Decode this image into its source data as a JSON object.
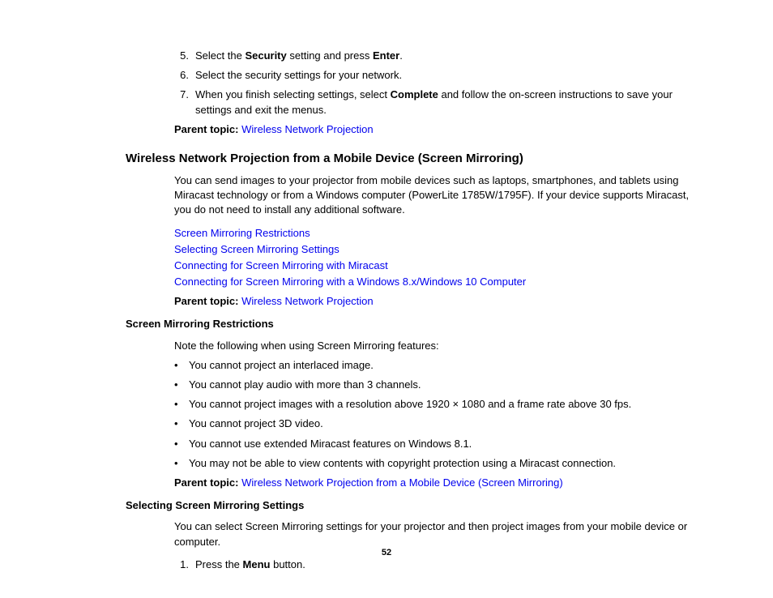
{
  "steps": [
    {
      "num": "5.",
      "prefix": "Select the ",
      "bold1": "Security",
      "mid": " setting and press ",
      "bold2": "Enter",
      "suffix": "."
    },
    {
      "num": "6.",
      "text": "Select the security settings for your network."
    },
    {
      "num": "7.",
      "prefix": "When you finish selecting settings, select ",
      "bold1": "Complete",
      "suffix": " and follow the on-screen instructions to save your settings and exit the menus."
    }
  ],
  "parentTopic1": {
    "label": "Parent topic:",
    "link": "Wireless Network Projection"
  },
  "heading1": "Wireless Network Projection from a Mobile Device (Screen Mirroring)",
  "intro1": "You can send images to your projector from mobile devices such as laptops, smartphones, and tablets using Miracast technology or from a Windows computer (PowerLite 1785W/1795F). If your device supports Miracast, you do not need to install any additional software.",
  "links1": [
    "Screen Mirroring Restrictions",
    "Selecting Screen Mirroring Settings",
    "Connecting for Screen Mirroring with Miracast",
    "Connecting for Screen Mirroring with a Windows 8.x/Windows 10 Computer"
  ],
  "parentTopic2": {
    "label": "Parent topic:",
    "link": "Wireless Network Projection"
  },
  "subheading1": "Screen Mirroring Restrictions",
  "note1": "Note the following when using Screen Mirroring features:",
  "bullets": [
    "You cannot project an interlaced image.",
    "You cannot play audio with more than 3 channels.",
    "You cannot project images with a resolution above 1920 × 1080 and a frame rate above 30 fps.",
    "You cannot project 3D video.",
    "You cannot use extended Miracast features on Windows 8.1.",
    "You may not be able to view contents with copyright protection using a Miracast connection."
  ],
  "parentTopic3": {
    "label": "Parent topic:",
    "link": "Wireless Network Projection from a Mobile Device (Screen Mirroring)"
  },
  "subheading2": "Selecting Screen Mirroring Settings",
  "intro2": "You can select Screen Mirroring settings for your projector and then project images from your mobile device or computer.",
  "step2": {
    "num": "1.",
    "prefix": "Press the ",
    "bold": "Menu",
    "suffix": " button."
  },
  "pageNum": "52"
}
